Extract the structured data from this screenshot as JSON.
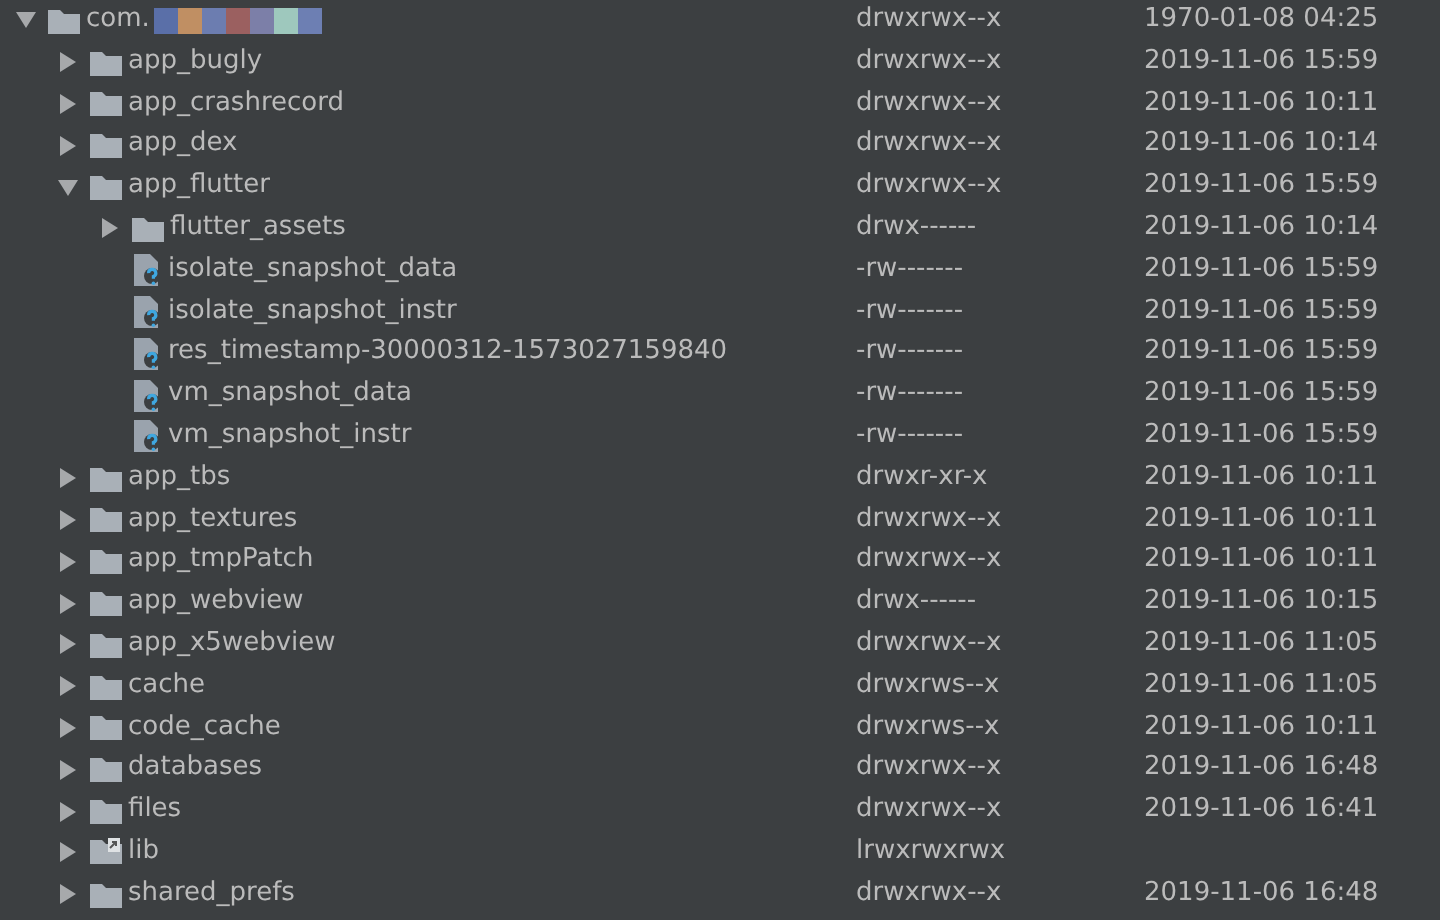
{
  "tree": [
    {
      "name": "com.",
      "kind": "folder",
      "expanded": true,
      "permissions": "drwxrwx--x",
      "date": "1970-01-08 04:25",
      "children": [
        {
          "name": "app_bugly",
          "kind": "folder",
          "expanded": false,
          "permissions": "drwxrwx--x",
          "date": "2019-11-06 15:59"
        },
        {
          "name": "app_crashrecord",
          "kind": "folder",
          "expanded": false,
          "permissions": "drwxrwx--x",
          "date": "2019-11-06 10:11"
        },
        {
          "name": "app_dex",
          "kind": "folder",
          "expanded": false,
          "permissions": "drwxrwx--x",
          "date": "2019-11-06 10:14"
        },
        {
          "name": "app_flutter",
          "kind": "folder",
          "expanded": true,
          "permissions": "drwxrwx--x",
          "date": "2019-11-06 15:59",
          "children": [
            {
              "name": "flutter_assets",
              "kind": "folder",
              "expanded": false,
              "permissions": "drwx------",
              "date": "2019-11-06 10:14"
            },
            {
              "name": "isolate_snapshot_data",
              "kind": "file",
              "permissions": "-rw-------",
              "date": "2019-11-06 15:59"
            },
            {
              "name": "isolate_snapshot_instr",
              "kind": "file",
              "permissions": "-rw-------",
              "date": "2019-11-06 15:59"
            },
            {
              "name": "res_timestamp-30000312-1573027159840",
              "kind": "file",
              "permissions": "-rw-------",
              "date": "2019-11-06 15:59"
            },
            {
              "name": "vm_snapshot_data",
              "kind": "file",
              "permissions": "-rw-------",
              "date": "2019-11-06 15:59"
            },
            {
              "name": "vm_snapshot_instr",
              "kind": "file",
              "permissions": "-rw-------",
              "date": "2019-11-06 15:59"
            }
          ]
        },
        {
          "name": "app_tbs",
          "kind": "folder",
          "expanded": false,
          "permissions": "drwxr-xr-x",
          "date": "2019-11-06 10:11"
        },
        {
          "name": "app_textures",
          "kind": "folder",
          "expanded": false,
          "permissions": "drwxrwx--x",
          "date": "2019-11-06 10:11"
        },
        {
          "name": "app_tmpPatch",
          "kind": "folder",
          "expanded": false,
          "permissions": "drwxrwx--x",
          "date": "2019-11-06 10:11"
        },
        {
          "name": "app_webview",
          "kind": "folder",
          "expanded": false,
          "permissions": "drwx------",
          "date": "2019-11-06 10:15"
        },
        {
          "name": "app_x5webview",
          "kind": "folder",
          "expanded": false,
          "permissions": "drwxrwx--x",
          "date": "2019-11-06 11:05"
        },
        {
          "name": "cache",
          "kind": "folder",
          "expanded": false,
          "permissions": "drwxrws--x",
          "date": "2019-11-06 11:05"
        },
        {
          "name": "code_cache",
          "kind": "folder",
          "expanded": false,
          "permissions": "drwxrws--x",
          "date": "2019-11-06 10:11"
        },
        {
          "name": "databases",
          "kind": "folder",
          "expanded": false,
          "permissions": "drwxrwx--x",
          "date": "2019-11-06 16:48"
        },
        {
          "name": "files",
          "kind": "folder",
          "expanded": false,
          "permissions": "drwxrwx--x",
          "date": "2019-11-06 16:41"
        },
        {
          "name": "lib",
          "kind": "link",
          "expanded": false,
          "permissions": "lrwxrwxrwx"
        },
        {
          "name": "shared_prefs",
          "kind": "folder",
          "expanded": false,
          "permissions": "drwxrwx--x",
          "date": "2019-11-06 16:48"
        }
      ]
    }
  ]
}
